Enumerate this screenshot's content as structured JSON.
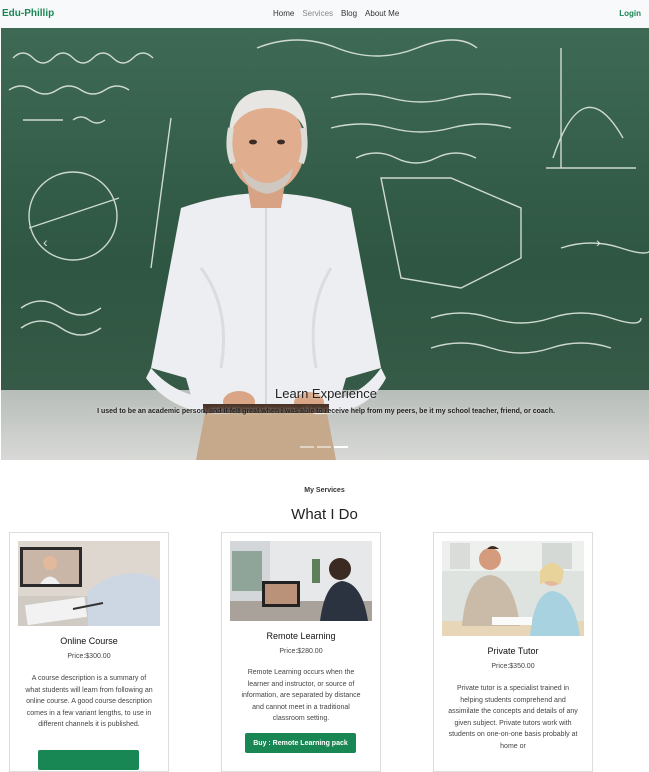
{
  "nav": {
    "brand": "Edu-Phillip",
    "links": [
      "Home",
      "Services",
      "Blog",
      "About Me"
    ],
    "login": "Login"
  },
  "hero": {
    "title": "Learn Experience",
    "text": "I used to be an academic person, and it felt great when I was able to receive help from my peers, be it my school teacher, friend, or coach."
  },
  "section": {
    "eyebrow": "My Services",
    "heading": "What I Do"
  },
  "cards": [
    {
      "title": "Online Course",
      "price": "Price:$300.00",
      "desc": "A course description is a summary of what students will learn from following an online course. A good course description comes in a few variant lengths, to use in different channels it is published."
    },
    {
      "title": "Remote Learning",
      "price": "Price:$280.00",
      "desc": "Remote Learning occurs when the learner and instructor, or source of information, are separated by distance and cannot meet in a traditional classroom setting.",
      "button": "Buy : Remote Learning pack"
    },
    {
      "title": "Private Tutor",
      "price": "Price:$350.00",
      "desc": "Private tutor is a specialist trained in helping students comprehend and assimilate the concepts and details of any given subject. Private tutors work with students on one-on-one basis probably at home or"
    }
  ],
  "colors": {
    "accent": "#198754",
    "nav_bg": "#f8f9fa"
  }
}
